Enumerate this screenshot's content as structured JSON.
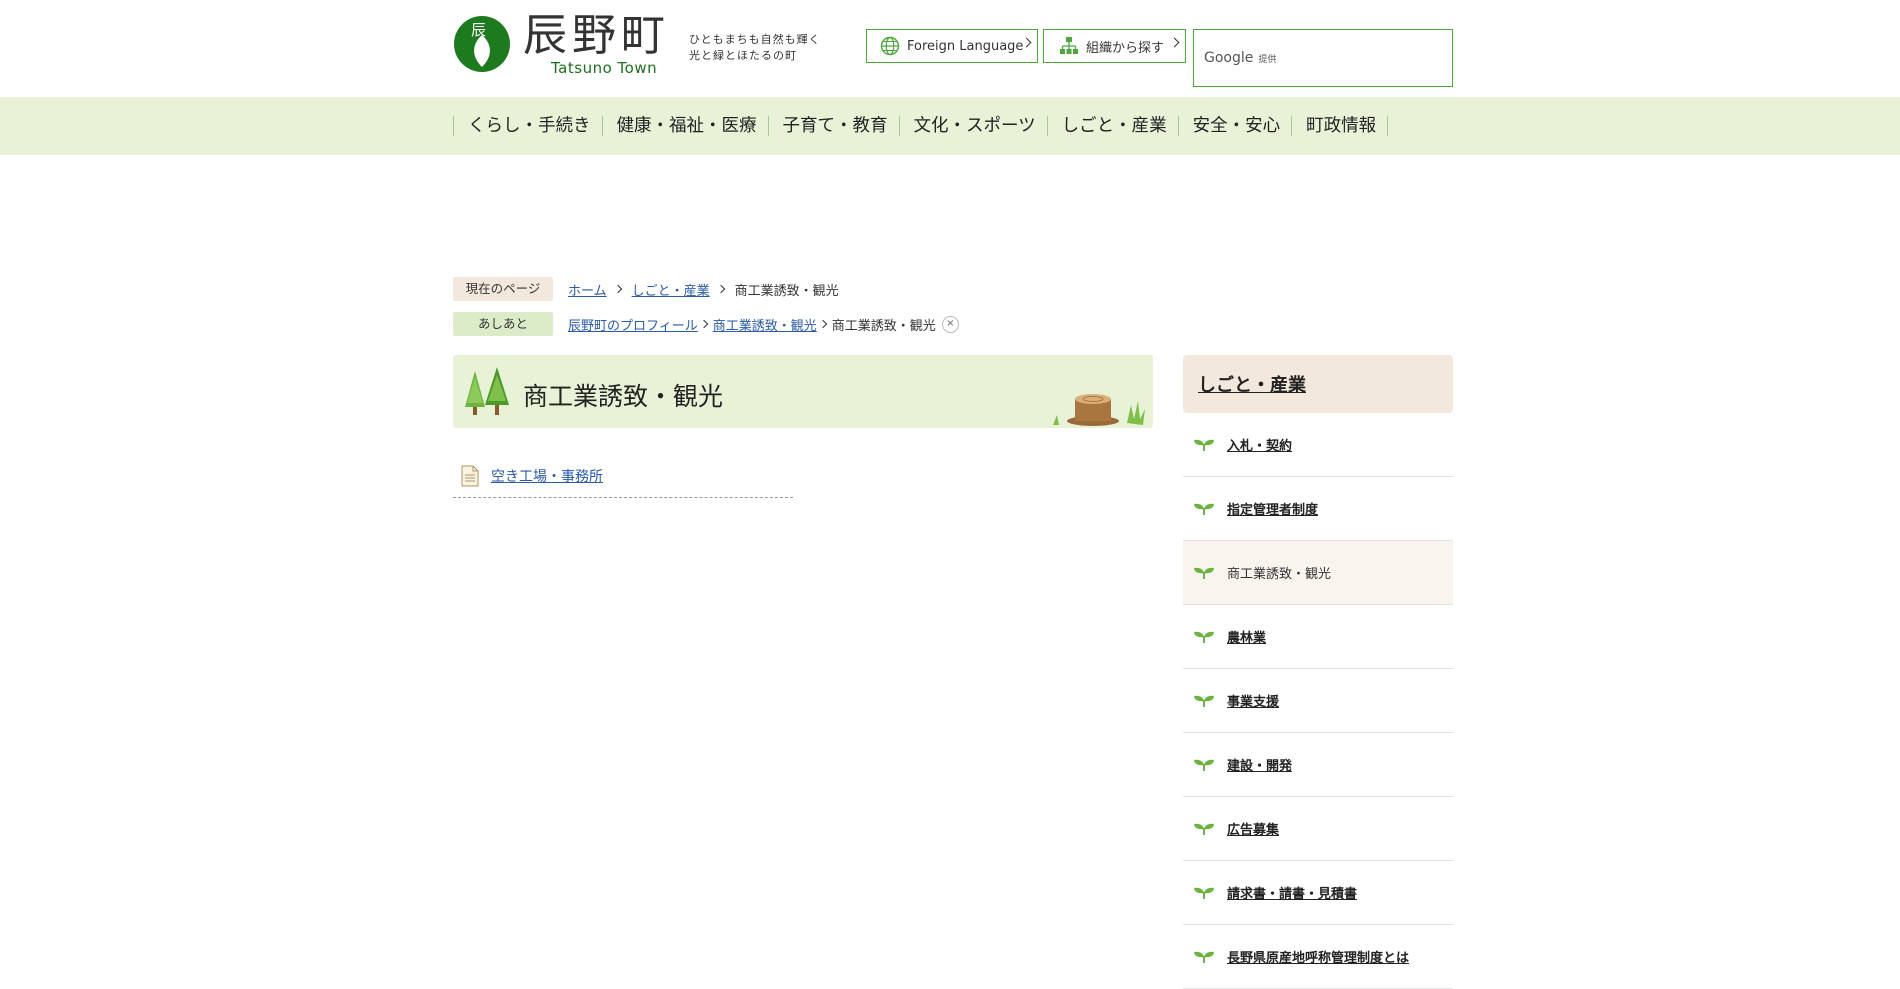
{
  "header": {
    "logo_char": "辰",
    "site_name": "辰野町",
    "site_name_en": "Tatsuno Town",
    "tagline": [
      "ひともまちも自然も輝く",
      "光と緑とほたるの町"
    ],
    "lang_button": "Foreign Language",
    "org_button": "組織から探す",
    "search_brand": "Google",
    "search_sub": "提供",
    "accent_color": "#4ea63c"
  },
  "gnav": {
    "items": [
      "くらし・手続き",
      "健康・福祉・医療",
      "子育て・教育",
      "文化・スポーツ",
      "しごと・産業",
      "安全・安心",
      "町政情報"
    ]
  },
  "breadcrumb": {
    "current_label": "現在のページ",
    "current": [
      "ホーム",
      "しごと・産業"
    ],
    "current_page": "商工業誘致・観光",
    "history_label": "あしあと",
    "history": [
      "辰野町のプロフィール",
      "商工業誘致・観光"
    ],
    "history_page": "商工業誘致・観光",
    "close": "×"
  },
  "main": {
    "title": "商工業誘致・観光",
    "documents": [
      "空き工場・事務所"
    ]
  },
  "sidebar": {
    "heading": "しごと・産業",
    "items": [
      "入札・契約",
      "指定管理者制度",
      "商工業誘致・観光",
      "農林業",
      "事業支援",
      "建設・開発",
      "広告募集",
      "請求書・請書・見積書",
      "長野県原産地呼称管理制度とは"
    ],
    "active_index": 2
  }
}
